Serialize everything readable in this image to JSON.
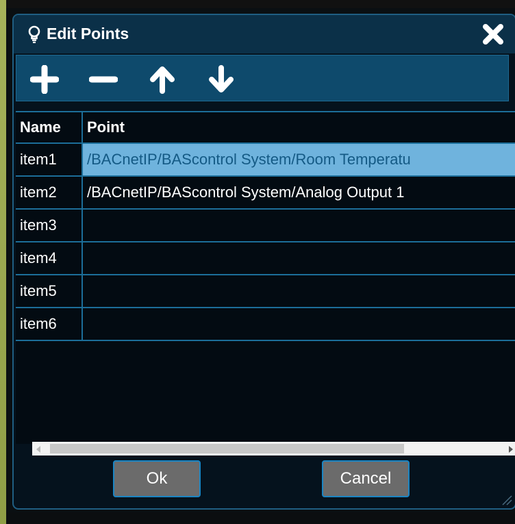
{
  "dialog": {
    "title": "Edit Points",
    "title_icon": "lightbulb-icon",
    "close_icon": "close-icon"
  },
  "toolbar": {
    "buttons": [
      {
        "icon": "plus-icon",
        "action": "add"
      },
      {
        "icon": "minus-icon",
        "action": "remove"
      },
      {
        "icon": "arrow-up-icon",
        "action": "move-up"
      },
      {
        "icon": "arrow-down-icon",
        "action": "move-down"
      }
    ]
  },
  "grid": {
    "columns": [
      "Name",
      "Point"
    ],
    "rows": [
      {
        "name": "item1",
        "point": "/BACnetIP/BAScontrol System/Room Temperatu",
        "selected": true
      },
      {
        "name": "item2",
        "point": "/BACnetIP/BAScontrol System/Analog Output 1",
        "selected": false
      },
      {
        "name": "item3",
        "point": "",
        "selected": false
      },
      {
        "name": "item4",
        "point": "",
        "selected": false
      },
      {
        "name": "item5",
        "point": "",
        "selected": false
      },
      {
        "name": "item6",
        "point": "",
        "selected": false
      }
    ]
  },
  "footer": {
    "ok_label": "Ok",
    "cancel_label": "Cancel"
  },
  "colors": {
    "title_bar": "#0b3048",
    "toolbar": "#0e4a6c",
    "grid_border": "#1c6e99",
    "selection": "#6fb3dd",
    "button": "#6b6b6b"
  }
}
